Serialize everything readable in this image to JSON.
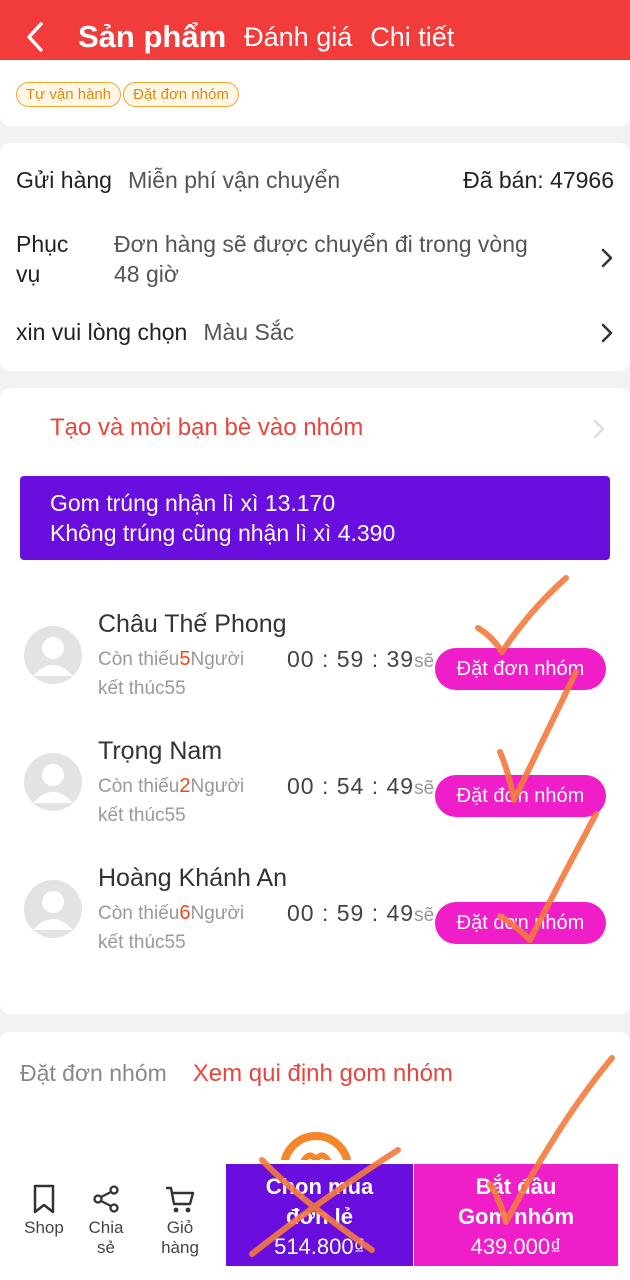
{
  "header": {
    "tabs": [
      {
        "label": "Sản phẩm"
      },
      {
        "label": "Đánh giá"
      },
      {
        "label": "Chi tiết"
      }
    ]
  },
  "tags": [
    "Tự vận hành",
    "Đặt đơn nhóm"
  ],
  "shipping": {
    "ship_label": "Gửi hàng",
    "ship_value": "Miễn phí vận chuyển",
    "sold": "Đã bán: 47966",
    "service_label_1": "Phục",
    "service_label_2": "vụ",
    "service_value_1": "Đơn hàng sẽ được chuyển đi trong vòng",
    "service_value_2": "48 giờ",
    "choose_label": "xin vui lòng chọn",
    "choose_value": "Màu Sắc"
  },
  "group_section": {
    "invite": "Tạo và mời bạn bè vào nhóm",
    "banner_line1": "Gom trúng nhận lì xì 13.170",
    "banner_line2": "Không trúng cũng nhận lì xì 4.390",
    "groups": [
      {
        "name": "Châu Thế Phong",
        "missing_prefix": "Còn thiếu",
        "missing": "5",
        "missing_suffix": "Người",
        "timer": "00 : 59 : 39",
        "timer_suffix": "sẽ",
        "end": "kết thúc55",
        "button": "Đặt đơn nhóm"
      },
      {
        "name": "Trọng Nam",
        "missing_prefix": "Còn thiếu",
        "missing": "2",
        "missing_suffix": "Người",
        "timer": "00 : 54 : 49",
        "timer_suffix": "sẽ",
        "end": "kết thúc55",
        "button": "Đặt đơn nhóm"
      },
      {
        "name": "Hoàng Khánh An",
        "missing_prefix": "Còn thiếu",
        "missing": "6",
        "missing_suffix": "Người",
        "timer": "00 : 59 : 49",
        "timer_suffix": "sẽ",
        "end": "kết thúc55",
        "button": "Đặt đơn nhóm"
      }
    ]
  },
  "rules": {
    "label": "Đặt đơn nhóm",
    "link": "Xem qui định gom nhóm"
  },
  "bottom_bar": {
    "shop": "Shop",
    "share": "Chia sẻ",
    "cart": "Giỏ hàng",
    "buy_single_line1": "Chọn mua",
    "buy_single_line2": "đơn lẻ",
    "buy_single_price": "514.800₫",
    "buy_group_line1": "Bắt đầu",
    "buy_group_line2": "Gom nhóm",
    "buy_group_price": "439.000₫"
  },
  "colors": {
    "header": "#f23c3c",
    "purple": "#6a0ee0",
    "magenta": "#f01ec8",
    "annotation": "#f47a3c"
  }
}
